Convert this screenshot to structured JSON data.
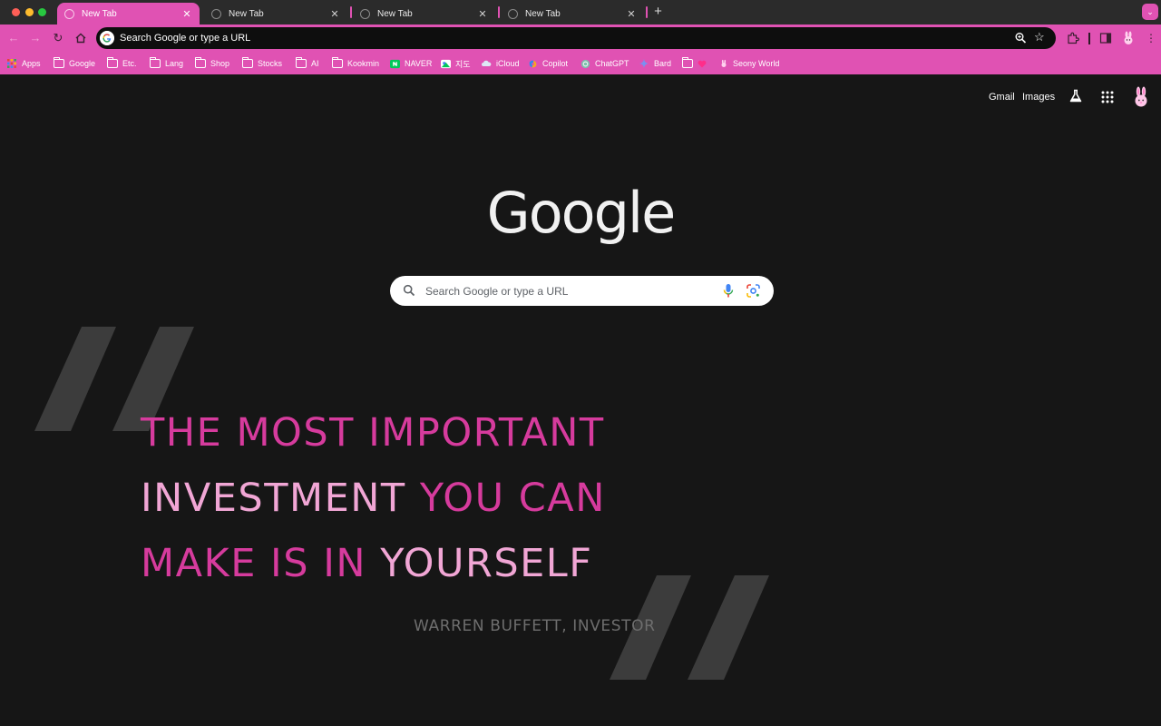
{
  "tabs": [
    {
      "title": "New Tab",
      "active": true
    },
    {
      "title": "New Tab",
      "active": false
    },
    {
      "title": "New Tab",
      "active": false
    },
    {
      "title": "New Tab",
      "active": false
    }
  ],
  "omnibox": {
    "placeholder": "Search Google or type a URL"
  },
  "bookmarks": [
    {
      "label": "Apps",
      "icon": "apps-grid-icon"
    },
    {
      "label": "Google",
      "icon": "folder-icon"
    },
    {
      "label": "Etc.",
      "icon": "folder-icon"
    },
    {
      "label": "Lang",
      "icon": "folder-icon"
    },
    {
      "label": "Shop",
      "icon": "folder-icon"
    },
    {
      "label": "Stocks",
      "icon": "folder-icon"
    },
    {
      "label": "AI",
      "icon": "folder-icon"
    },
    {
      "label": "Kookmin",
      "icon": "folder-icon"
    },
    {
      "label": "NAVER",
      "icon": "naver-icon"
    },
    {
      "label": "지도",
      "icon": "map-icon"
    },
    {
      "label": "iCloud",
      "icon": "icloud-icon"
    },
    {
      "label": "Copilot",
      "icon": "copilot-icon"
    },
    {
      "label": "ChatGPT",
      "icon": "chatgpt-icon"
    },
    {
      "label": "Bard",
      "icon": "bard-icon"
    },
    {
      "label": "",
      "icon": "folder-heart-icon"
    },
    {
      "label": "Seony World",
      "icon": "bunny-icon"
    }
  ],
  "header_links": {
    "gmail": "Gmail",
    "images": "Images"
  },
  "logo_text": "Google",
  "search": {
    "placeholder": "Search Google or type a URL"
  },
  "quote": {
    "line1": [
      {
        "text": "THE MOST IMPORTANT",
        "tone": "pink"
      }
    ],
    "line2": [
      {
        "text": "INVESTMENT ",
        "tone": "light"
      },
      {
        "text": "YOU CAN",
        "tone": "pink"
      }
    ],
    "line3": [
      {
        "text": "MAKE IS IN ",
        "tone": "pink"
      },
      {
        "text": "YOURSELF",
        "tone": "light"
      }
    ],
    "attribution": "WARREN BUFFETT, INVESTOR"
  },
  "colors": {
    "theme_accent": "#e052b3",
    "quote_pink": "#d63b9d",
    "quote_light_pink": "#f1a6d5",
    "page_background": "#161616"
  }
}
